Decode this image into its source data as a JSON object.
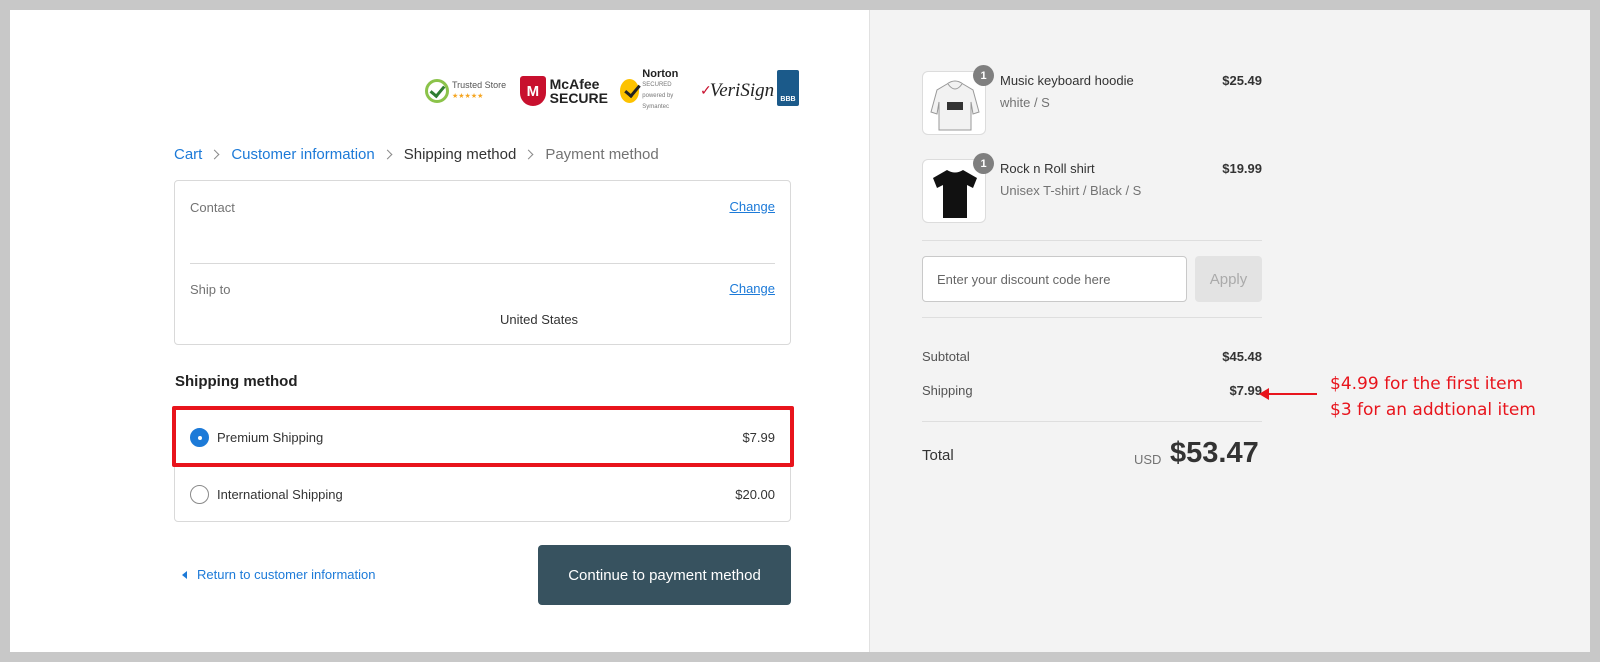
{
  "badges": {
    "trusted_store": {
      "small": "Trusted Store",
      "stars": "★★★★★"
    },
    "mcafee": {
      "line1": "McAfee",
      "line2": "SECURE",
      "mark": "M"
    },
    "norton": {
      "line1": "Norton",
      "line2": "SECURED",
      "sub": "powered by Symantec"
    },
    "verisign": {
      "text": "VeriSign"
    },
    "bbb": {
      "text": "BBB"
    }
  },
  "breadcrumb": {
    "cart": "Cart",
    "customer_info": "Customer information",
    "shipping_method": "Shipping method",
    "payment_method": "Payment method"
  },
  "contact_box": {
    "contact_label": "Contact",
    "change_label": "Change",
    "ship_to_label": "Ship to",
    "ship_to_value": "United States"
  },
  "shipping": {
    "title": "Shipping method",
    "options": [
      {
        "label": "Premium Shipping",
        "price": "$7.99",
        "selected": true
      },
      {
        "label": "International Shipping",
        "price": "$20.00",
        "selected": false
      }
    ]
  },
  "actions": {
    "return_label": "Return to customer information",
    "continue_label": "Continue to payment method"
  },
  "summary": {
    "products": [
      {
        "name": "Music keyboard hoodie",
        "variant": "white / S",
        "price": "$25.49",
        "qty": "1"
      },
      {
        "name": "Rock n Roll shirt",
        "variant": "Unisex T-shirt / Black / S",
        "price": "$19.99",
        "qty": "1"
      }
    ],
    "discount_placeholder": "Enter your discount code here",
    "apply_label": "Apply",
    "subtotal_label": "Subtotal",
    "subtotal": "$45.48",
    "shipping_label": "Shipping",
    "shipping": "$7.99",
    "total_label": "Total",
    "currency": "USD",
    "total": "$53.47"
  },
  "annotation": {
    "line1": "$4.99 for the first item",
    "line2": "$3 for an addtional item"
  },
  "colors": {
    "link": "#1c7ad8",
    "button": "#37525f",
    "highlight": "#e8141c",
    "sidebar_bg": "#f3f3f3"
  }
}
